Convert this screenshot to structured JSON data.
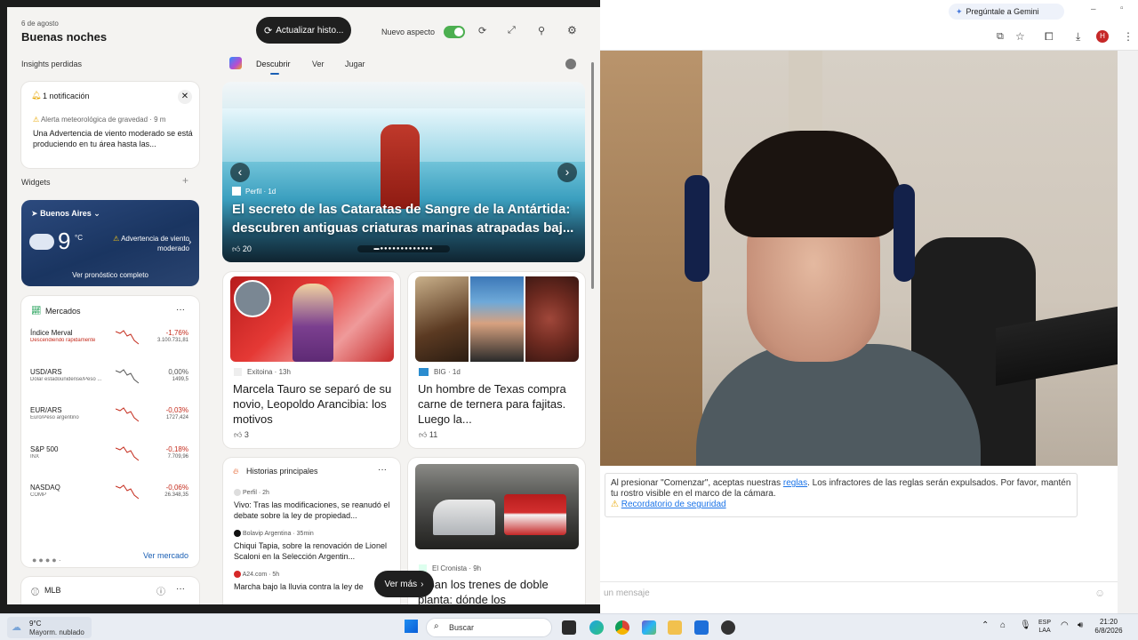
{
  "top": {
    "date": "6 de agosto",
    "greeting": "Buenas noches",
    "update_btn": "Actualizar histo...",
    "new_look": "Nuevo aspecto"
  },
  "tabs": [
    "Descubrir",
    "Ver",
    "Jugar"
  ],
  "insights": {
    "title": "Insights perdidas",
    "notif_count": "1 notificación",
    "alert_label": "Alerta meteorológica de gravedad · 9 m",
    "alert_text": "Una Advertencia de viento moderado se está produciendo en tu área hasta las..."
  },
  "widgets": {
    "title": "Widgets",
    "add": "+",
    "city": "Buenos Aires",
    "temp": "9",
    "unit": "°C",
    "warning": "Advertencia de viento moderado",
    "forecast": "Ver pronóstico completo"
  },
  "markets": {
    "title": "Mercados",
    "more": "···",
    "items": [
      {
        "name": "Índice Merval",
        "sub": "Descendiendo rápidamente",
        "pct": "-1,76%",
        "val": "3.100.731,81",
        "color": "#c42b1c"
      },
      {
        "name": "USD/ARS",
        "sub": "Dólar estadounidense/Peso ...",
        "pct": "0,00%",
        "val": "1499,5",
        "color": "#555555"
      },
      {
        "name": "EUR/ARS",
        "sub": "Euro/Peso argentino",
        "pct": "-0,03%",
        "val": "1727,424",
        "color": "#c42b1c"
      },
      {
        "name": "S&P 500",
        "sub": "INX",
        "pct": "-0,18%",
        "val": "7.709,96",
        "color": "#c42b1c"
      },
      {
        "name": "NASDAQ",
        "sub": "COMP",
        "pct": "-0,06%",
        "val": "26.348,35",
        "color": "#c42b1c"
      }
    ],
    "link": "Ver mercado"
  },
  "mlb": {
    "title": "MLB"
  },
  "hero": {
    "source": "Perfil · 1d",
    "title": "El secreto de las Cataratas de Sangre de la Antártida: descubren antiguas criaturas marinas atrapadas baj...",
    "likes": "20"
  },
  "news1": {
    "source": "Exitoina · 13h",
    "title": "Marcela Tauro se separó de su novio, Leopoldo Arancibia: los motivos",
    "likes": "3"
  },
  "news2": {
    "source": "BIG · 1d",
    "title": "Un hombre de Texas compra carne de ternera para fajitas. Luego la...",
    "likes": "11"
  },
  "stories": {
    "title": "Historias principales",
    "items": [
      {
        "source": "Perfil · 2h",
        "text": "Vivo: Tras las modificaciones, se reanudó el debate sobre la ley de propiedad..."
      },
      {
        "source": "Bolavip Argentina · 35min",
        "text": "Chiqui Tapia, sobre la renovación de Lionel Scaloni en la Selección Argentin..."
      },
      {
        "source": "A24.com · 5h",
        "text": "Marcha bajo la lluvia contra la ley de"
      }
    ]
  },
  "news3": {
    "source": "El Cronista · 9h",
    "title": "rriban los trenes de doble planta: dónde los"
  },
  "see_more": "Ver más",
  "browser": {
    "gemini": "Pregúntale a Gemini",
    "avatar": "H",
    "notice_a": "Al presionar \"Comenzar\", aceptas nuestras ",
    "notice_link": "reglas",
    "notice_b": ". Los infractores de las reglas serán expulsados. Por favor, mantén tu rostro visible en el marco de la cámara.",
    "reminder": "Recordatorio de seguridad",
    "msg_placeholder": "un mensaje"
  },
  "taskbar": {
    "temp": "9°C",
    "weather": "Mayorm. nublado",
    "search": "Buscar",
    "lang1": "ESP",
    "lang2": "LAA",
    "time": "21:20",
    "date": "6/8/2026"
  }
}
